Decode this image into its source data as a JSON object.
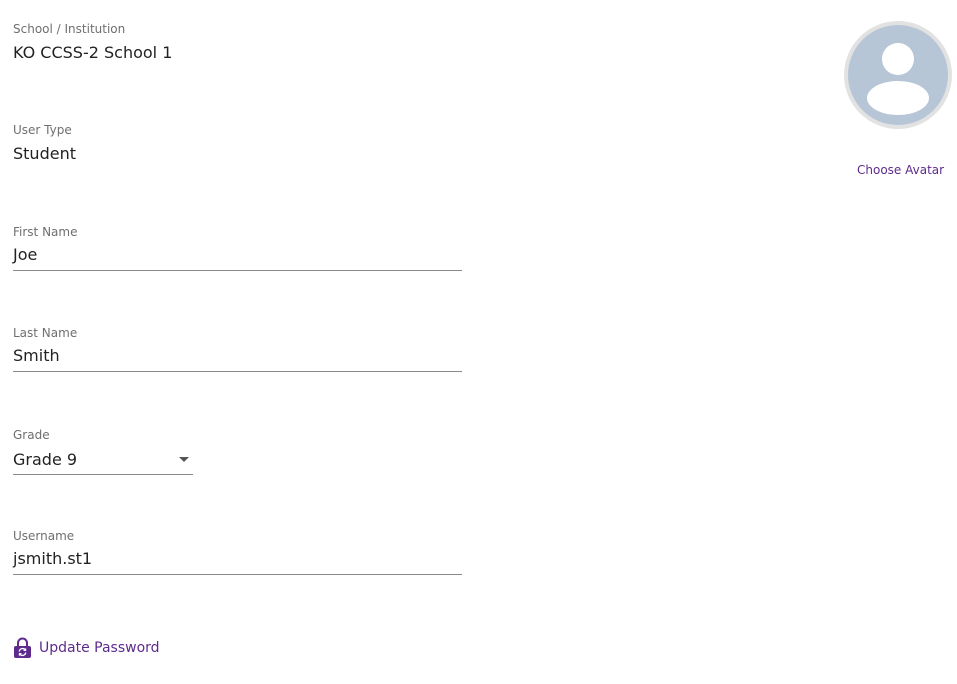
{
  "profile": {
    "school": {
      "label": "School / Institution",
      "value": "KO CCSS-2 School 1"
    },
    "user_type": {
      "label": "User Type",
      "value": "Student"
    },
    "first_name": {
      "label": "First Name",
      "value": "Joe"
    },
    "last_name": {
      "label": "Last Name",
      "value": "Smith"
    },
    "grade": {
      "label": "Grade",
      "value": "Grade 9"
    },
    "username": {
      "label": "Username",
      "value": "jsmith.st1"
    }
  },
  "avatar": {
    "choose_label": "Choose Avatar",
    "icon": "default-person-icon"
  },
  "actions": {
    "update_password_label": "Update Password",
    "update_password_icon": "lock-refresh-icon"
  },
  "colors": {
    "accent": "#5e2b8c",
    "avatar_bg": "#b7c6d6",
    "avatar_ring": "#e2e2e2"
  }
}
